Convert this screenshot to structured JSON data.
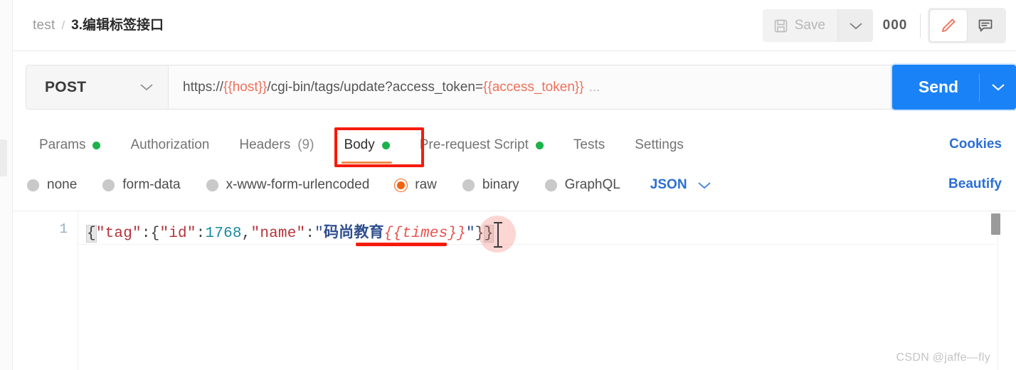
{
  "header": {
    "breadcrumb": {
      "root": "test",
      "separator": "/",
      "current": "3.编辑标签接口"
    },
    "save_label": "Save",
    "save_icon": "floppy-disk-icon",
    "save_caret_icon": "chevron-down-icon",
    "more_label": "000",
    "edit_icon": "pencil-icon",
    "comment_icon": "comment-icon"
  },
  "request": {
    "method": "POST",
    "method_caret_icon": "chevron-down-icon",
    "url": {
      "prefix": "https://",
      "host_var": "{{host}}",
      "path": "/cgi-bin/tags/update?access_token=",
      "token_var": "{{access_token}}",
      "ellipsis": "..."
    },
    "send_label": "Send",
    "send_caret_icon": "chevron-down-icon",
    "send_color": "#1a82f7"
  },
  "tabs": {
    "items": [
      {
        "label": "Params",
        "dot": true,
        "count": "",
        "active": false
      },
      {
        "label": "Authorization",
        "dot": false,
        "count": "",
        "active": false
      },
      {
        "label": "Headers",
        "dot": false,
        "count": "(9)",
        "active": false
      },
      {
        "label": "Body",
        "dot": true,
        "count": "",
        "active": true
      },
      {
        "label": "Pre-request Script",
        "dot": true,
        "count": "",
        "active": false
      },
      {
        "label": "Tests",
        "dot": false,
        "count": "",
        "active": false
      },
      {
        "label": "Settings",
        "dot": false,
        "count": "",
        "active": false
      }
    ],
    "dot_color": "#1bb34a",
    "active_underline_color": "#f08a4b",
    "cookies_label": "Cookies"
  },
  "body_type": {
    "options": [
      {
        "label": "none",
        "selected": false
      },
      {
        "label": "form-data",
        "selected": false
      },
      {
        "label": "x-www-form-urlencoded",
        "selected": false
      },
      {
        "label": "raw",
        "selected": true
      },
      {
        "label": "binary",
        "selected": false
      },
      {
        "label": "GraphQL",
        "selected": false
      }
    ],
    "format_selected": "JSON",
    "format_caret_icon": "chevron-down-icon",
    "selected_color": "#f2620f",
    "beautify_label": "Beautify"
  },
  "editor": {
    "line_number": "1",
    "tokens": [
      {
        "text": "{",
        "type": "brace-hl"
      },
      {
        "text": "\"tag\"",
        "type": "key"
      },
      {
        "text": ":",
        "type": "punct"
      },
      {
        "text": "{",
        "type": "punct"
      },
      {
        "text": "\"id\"",
        "type": "key"
      },
      {
        "text": ":",
        "type": "punct"
      },
      {
        "text": "1768",
        "type": "num"
      },
      {
        "text": ",",
        "type": "punct"
      },
      {
        "text": "\"name\"",
        "type": "key"
      },
      {
        "text": ":",
        "type": "punct"
      },
      {
        "text": "\"",
        "type": "str"
      },
      {
        "text": "码尚教育",
        "type": "cjk"
      },
      {
        "text": "{{times}}",
        "type": "var"
      },
      {
        "text": "\"",
        "type": "str"
      },
      {
        "text": "}",
        "type": "punct"
      },
      {
        "text": "}",
        "type": "brace-hl"
      }
    ],
    "annotation_underline_color": "#f51b0c",
    "cursor_icon": "text-cursor-ibeam"
  },
  "annotation": {
    "box_color": "#f51b0c",
    "target": "Body"
  },
  "watermark": "CSDN @jaffe—fly"
}
